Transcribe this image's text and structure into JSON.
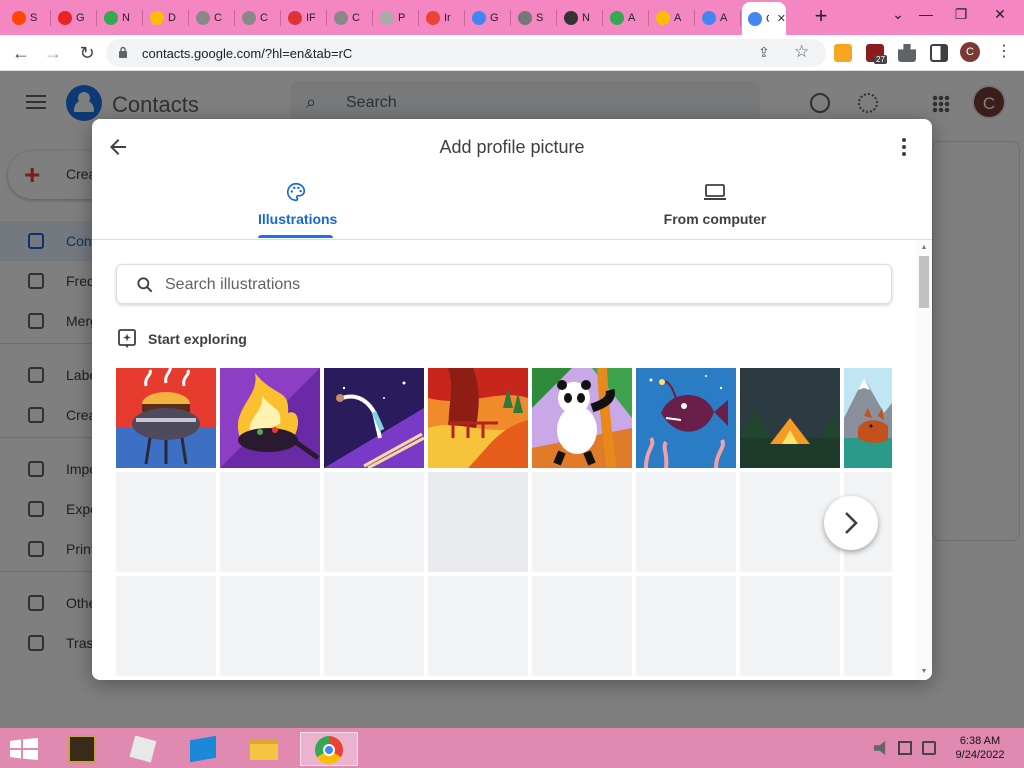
{
  "browser": {
    "tabs": [
      {
        "label": "S",
        "color": "#ff4500"
      },
      {
        "label": "G",
        "color": "#e22"
      },
      {
        "label": "N",
        "color": "#34a853"
      },
      {
        "label": "D",
        "color": "#fbbc04"
      },
      {
        "label": "C",
        "color": "#888"
      },
      {
        "label": "C",
        "color": "#888"
      },
      {
        "label": "IF",
        "color": "#d33"
      },
      {
        "label": "C",
        "color": "#888"
      },
      {
        "label": "P",
        "color": "#aaa"
      },
      {
        "label": "Ir",
        "color": "#ea4335"
      },
      {
        "label": "G",
        "color": "#4285f4"
      },
      {
        "label": "S",
        "color": "#777"
      },
      {
        "label": "N",
        "color": "#333"
      },
      {
        "label": "A",
        "color": "#34a853"
      },
      {
        "label": "A",
        "color": "#fbbc04"
      },
      {
        "label": "A",
        "color": "#4285f4"
      },
      {
        "label": "G",
        "color": "#4285f4",
        "active": true
      }
    ],
    "new_tab": "+",
    "url": "contacts.google.com/?hl=en&tab=rC",
    "extension_badge": "27",
    "profile_initial": "C"
  },
  "contacts_app": {
    "title": "Contacts",
    "search_placeholder": "Search",
    "avatar_initial": "C",
    "create_label": "Create contact",
    "sidebar": [
      {
        "label": "Contacts",
        "active": true
      },
      {
        "label": "Frequently contacted"
      },
      {
        "label": "Merge & fix"
      },
      {
        "label": "Labels"
      },
      {
        "label": "Create label"
      },
      {
        "label": "Import"
      },
      {
        "label": "Export"
      },
      {
        "label": "Print"
      },
      {
        "label": "Other contacts"
      },
      {
        "label": "Trash"
      }
    ]
  },
  "dialog": {
    "title": "Add profile picture",
    "tabs": [
      {
        "label": "Illustrations",
        "icon": "palette-icon",
        "selected": true
      },
      {
        "label": "From computer",
        "icon": "laptop-icon",
        "selected": false
      }
    ],
    "search_placeholder": "Search illustrations",
    "section_label": "Start exploring",
    "illustrations": [
      {
        "name": "burger-grill",
        "accent": "#e63b2e"
      },
      {
        "name": "fire-wok",
        "accent": "#8c3fc4"
      },
      {
        "name": "gymnast",
        "accent": "#5b2ea6"
      },
      {
        "name": "autumn-path",
        "accent": "#e8612c"
      },
      {
        "name": "panda",
        "accent": "#2e8b3a"
      },
      {
        "name": "anglerfish",
        "accent": "#2a7dc4"
      },
      {
        "name": "campfire-tent",
        "accent": "#2e4a3a"
      },
      {
        "name": "fox-mountain",
        "accent": "#39a3c9"
      }
    ]
  },
  "taskbar": {
    "time": "6:38 AM",
    "date": "9/24/2022"
  }
}
